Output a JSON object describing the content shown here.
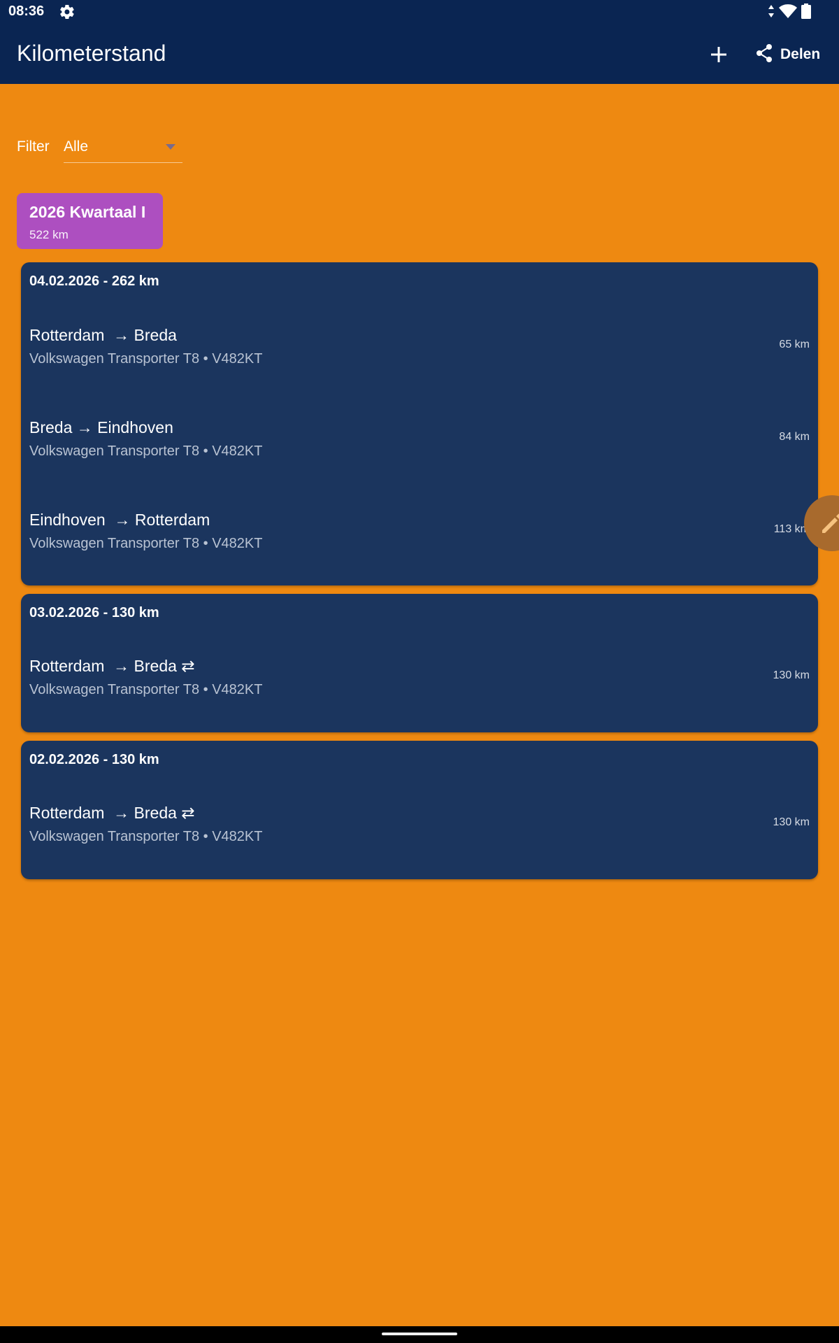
{
  "status_bar": {
    "time": "08:36"
  },
  "app_bar": {
    "title": "Kilometerstand",
    "share_label": "Delen"
  },
  "filter": {
    "label": "Filter",
    "value": "Alle"
  },
  "quarter": {
    "title": "2026 Kwartaal I",
    "total": "522 km"
  },
  "days": [
    {
      "header": "04.02.2026 - 262 km",
      "trips": [
        {
          "route": "Rotterdam  → Breda",
          "vehicle": "Volkswagen Transporter T8 • V482KT",
          "km": "65 km"
        },
        {
          "route": "Breda → Eindhoven",
          "vehicle": "Volkswagen Transporter T8 • V482KT",
          "km": "84 km"
        },
        {
          "route": "Eindhoven  → Rotterdam",
          "vehicle": "Volkswagen Transporter T8 • V482KT",
          "km": "113 km"
        }
      ]
    },
    {
      "header": "03.02.2026 - 130 km",
      "trips": [
        {
          "route": "Rotterdam  → Breda ⇄",
          "vehicle": "Volkswagen Transporter T8 • V482KT",
          "km": "130 km"
        }
      ]
    },
    {
      "header": "02.02.2026 - 130 km",
      "trips": [
        {
          "route": "Rotterdam  → Breda ⇄",
          "vehicle": "Volkswagen Transporter T8 • V482KT",
          "km": "130 km"
        }
      ]
    }
  ],
  "icons": {
    "settings": "gear-icon",
    "signal": "signal-icon",
    "wifi": "wifi-icon",
    "battery": "battery-icon",
    "add": "plus-icon",
    "share": "share-icon",
    "edit": "pencil-icon"
  },
  "colors": {
    "background": "#ee8911",
    "app_bar": "#0a2552",
    "card": "#1b355e",
    "quarter_chip": "#ad4fc0",
    "edit_fab": "#a86a2d"
  }
}
